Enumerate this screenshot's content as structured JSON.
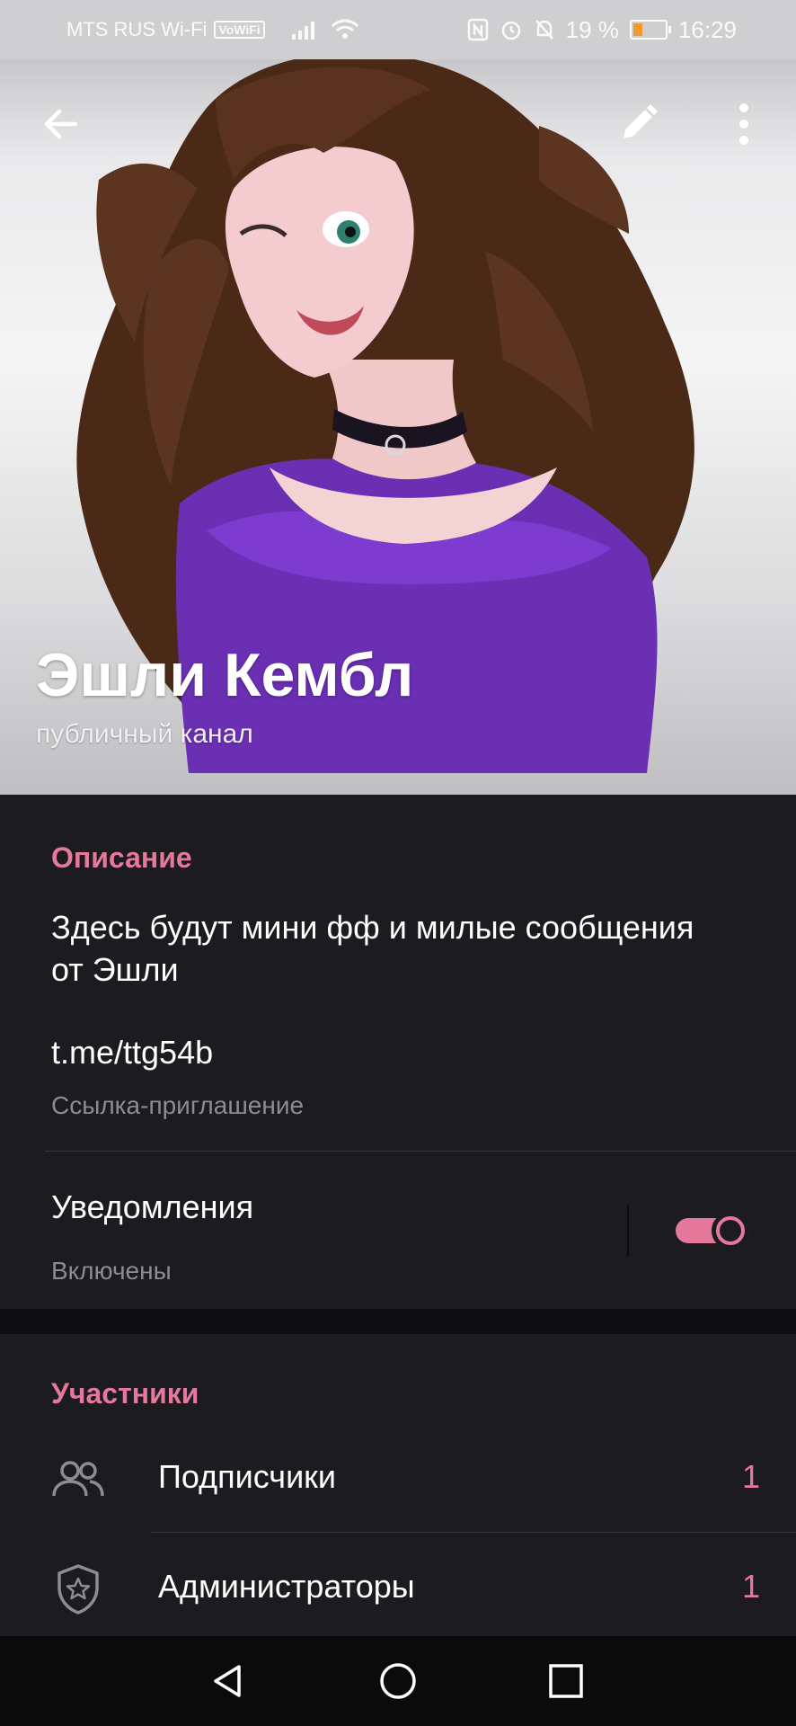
{
  "status_bar": {
    "carrier": "MTS RUS Wi-Fi",
    "vowifi": "VoWiFi",
    "battery": "19 %",
    "time": "16:29"
  },
  "header": {
    "title": "Эшли Кембл",
    "subtitle": "публичный канал"
  },
  "info": {
    "description_header": "Описание",
    "description_text": "Здесь будут мини фф и милые сообщения от Эшли",
    "invite_link": "t.me/ttg54b",
    "invite_caption": "Ссылка-приглашение",
    "notifications_label": "Уведомления",
    "notifications_state": "Включены",
    "notifications_enabled": true
  },
  "members": {
    "header": "Участники",
    "rows": [
      {
        "label": "Подписчики",
        "count": "1",
        "icon": "people-icon"
      },
      {
        "label": "Администраторы",
        "count": "1",
        "icon": "admin-shield-icon"
      }
    ]
  },
  "colors": {
    "accent": "#e4799b",
    "background": "#1c1b1f",
    "secondary_text": "#8e8c92"
  }
}
